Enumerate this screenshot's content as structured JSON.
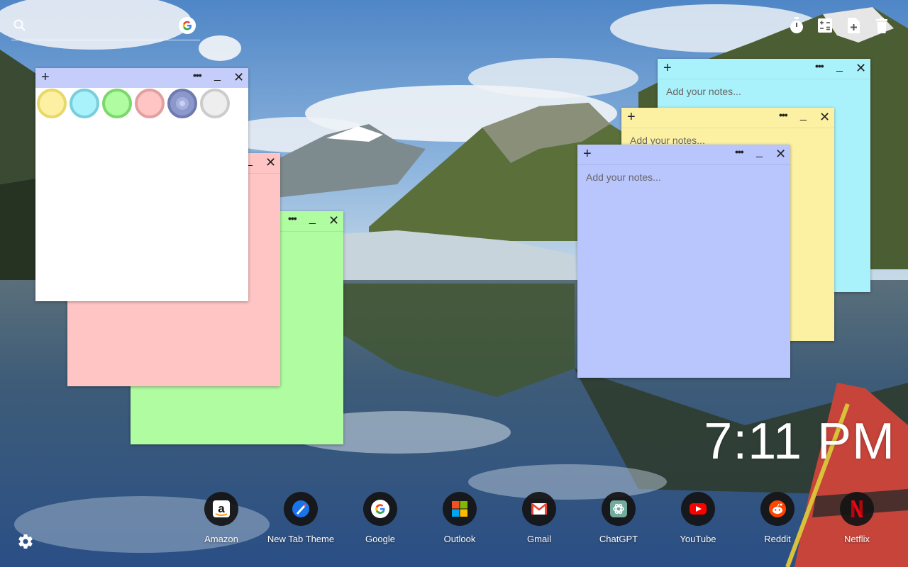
{
  "search": {
    "placeholder": "",
    "icon": "search-icon",
    "engine_icon": "google-icon"
  },
  "toolbar": [
    {
      "icon": "timer-icon"
    },
    {
      "icon": "calculator-icon"
    },
    {
      "icon": "add-note-file-icon"
    },
    {
      "icon": "trash-icon"
    }
  ],
  "notes": {
    "palette_note": {
      "color": "#ffffff",
      "header_color": "#c5cdfb",
      "add": "+",
      "more": "•••",
      "min": "_",
      "close": "✕"
    },
    "pink_note": {
      "color": "#ffc4c4",
      "add": "+",
      "more": "•••",
      "min": "_",
      "close": "✕"
    },
    "green_note": {
      "color": "#b0fca0",
      "add": "+",
      "more": "•••",
      "min": "_",
      "close": "✕"
    },
    "cyan_note": {
      "color": "#aaf2fb",
      "placeholder": "Add your notes...",
      "add": "+",
      "more": "•••",
      "min": "_",
      "close": "✕"
    },
    "yellow_note": {
      "color": "#fcf0a3",
      "placeholder": "Add your notes...",
      "add": "+",
      "more": "•••",
      "min": "_",
      "close": "✕"
    },
    "blue_note": {
      "color": "#b9c5fd",
      "placeholder": "Add your notes...",
      "add": "+",
      "more": "•••",
      "min": "_",
      "close": "✕"
    }
  },
  "palette": [
    {
      "name": "yellow",
      "fill": "#fcf0a3",
      "ring": "#e8d86a"
    },
    {
      "name": "cyan",
      "fill": "#aaf2fb",
      "ring": "#78cedb"
    },
    {
      "name": "green",
      "fill": "#b0fca0",
      "ring": "#7cd86c"
    },
    {
      "name": "pink",
      "fill": "#ffc4c4",
      "ring": "#e2a0a0"
    },
    {
      "name": "blue",
      "fill": "#8c98cc",
      "ring": "#6e7ab0"
    },
    {
      "name": "gray",
      "fill": "#eeeeee",
      "ring": "#cccccc"
    }
  ],
  "clock": {
    "time": "7:11 PM"
  },
  "dock": [
    {
      "label": "Amazon",
      "icon": "amazon-icon"
    },
    {
      "label": "New Tab Theme",
      "icon": "new-tab-theme-icon"
    },
    {
      "label": "Google",
      "icon": "google-icon"
    },
    {
      "label": "Outlook",
      "icon": "outlook-icon"
    },
    {
      "label": "Gmail",
      "icon": "gmail-icon"
    },
    {
      "label": "ChatGPT",
      "icon": "chatgpt-icon"
    },
    {
      "label": "YouTube",
      "icon": "youtube-icon"
    },
    {
      "label": "Reddit",
      "icon": "reddit-icon"
    },
    {
      "label": "Netflix",
      "icon": "netflix-icon"
    }
  ],
  "settings": {
    "icon": "gear-icon"
  }
}
